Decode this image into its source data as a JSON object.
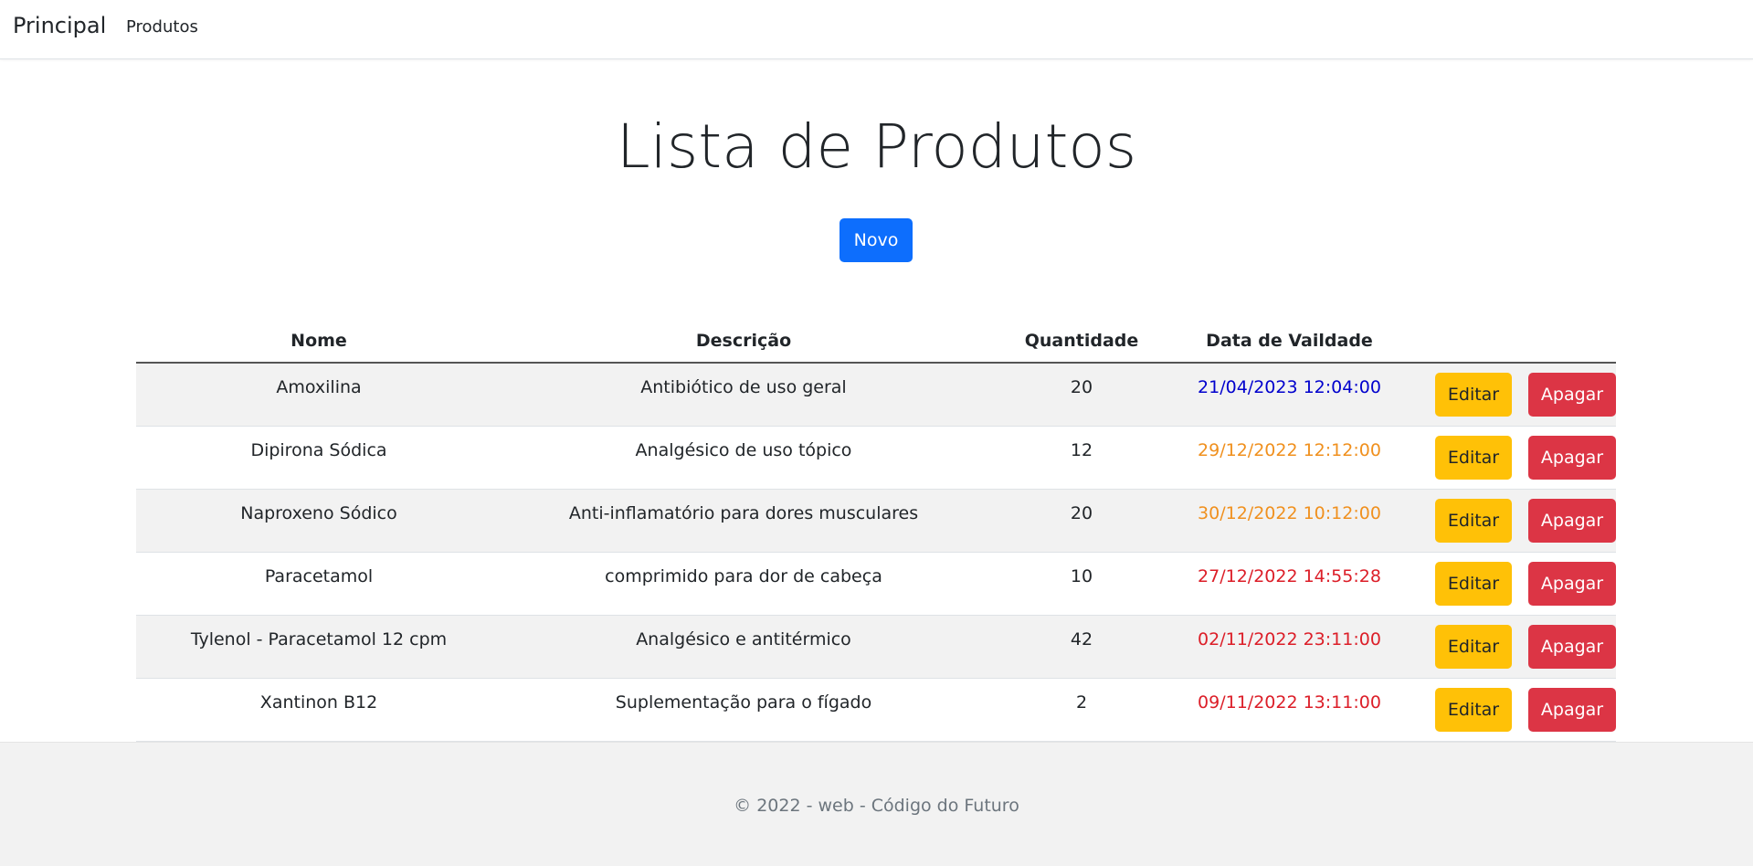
{
  "navbar": {
    "brand": "Principal",
    "links": [
      "Produtos"
    ]
  },
  "main": {
    "title": "Lista de Produtos",
    "new_button": "Novo"
  },
  "table": {
    "headers": [
      "Nome",
      "Descrição",
      "Quantidade",
      "Data de Vaildade"
    ],
    "edit_label": "Editar",
    "delete_label": "Apagar",
    "rows": [
      {
        "nome": "Amoxilina",
        "descricao": "Antibiótico de uso geral",
        "quantidade": "20",
        "data": "21/04/2023 12:04:00",
        "data_color": "#0000cd"
      },
      {
        "nome": "Dipirona Sódica",
        "descricao": "Analgésico de uso tópico",
        "quantidade": "12",
        "data": "29/12/2022 12:12:00",
        "data_color": "#f0901e"
      },
      {
        "nome": "Naproxeno Sódico",
        "descricao": "Anti-inflamatório para dores musculares",
        "quantidade": "20",
        "data": "30/12/2022 10:12:00",
        "data_color": "#f0901e"
      },
      {
        "nome": "Paracetamol",
        "descricao": "comprimido para dor de cabeça",
        "quantidade": "10",
        "data": "27/12/2022 14:55:28",
        "data_color": "#dc1e28"
      },
      {
        "nome": "Tylenol - Paracetamol 12 cpm",
        "descricao": "Analgésico e antitérmico",
        "quantidade": "42",
        "data": "02/11/2022 23:11:00",
        "data_color": "#dc1e28"
      },
      {
        "nome": "Xantinon B12",
        "descricao": "Suplementação para o fígado",
        "quantidade": "2",
        "data": "09/11/2022 13:11:00",
        "data_color": "#dc1e28"
      }
    ]
  },
  "footer": {
    "text": "© 2022 - web - Código do Futuro"
  },
  "colors": {
    "primary": "#0d6efd",
    "warning": "#ffc107",
    "danger": "#dc3545"
  }
}
